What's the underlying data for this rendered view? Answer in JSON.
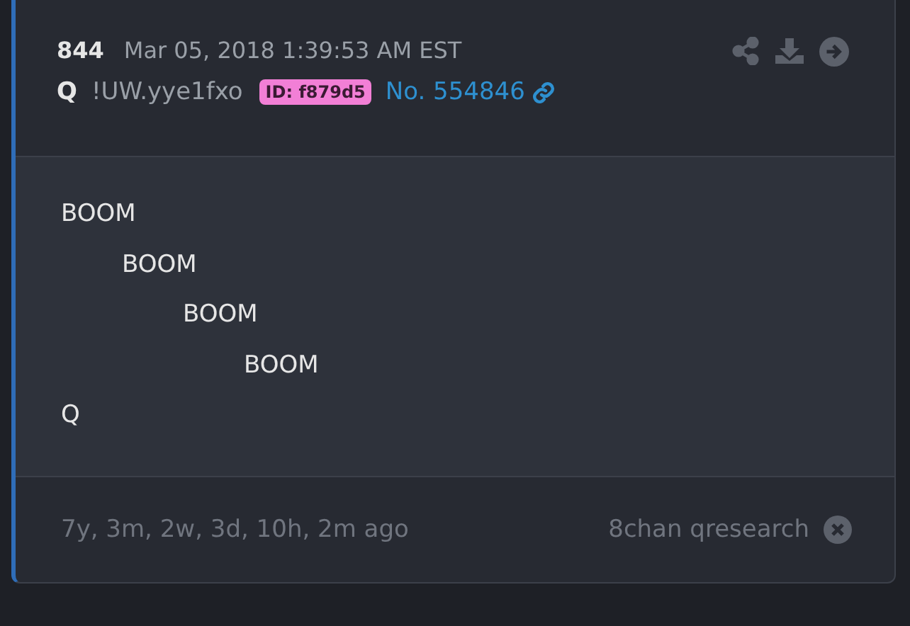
{
  "post": {
    "number": "844",
    "timestamp": "Mar 05, 2018 1:39:53 AM EST",
    "author": "Q",
    "tripcode": "!UW.yye1fxo",
    "id_badge": {
      "text": "ID: f879d5",
      "color": "#f27fd6"
    },
    "post_link": "No. 554846"
  },
  "body": {
    "lines": [
      {
        "text": "BOOM",
        "children": [
          {
            "text": "BOOM",
            "children": [
              {
                "text": "BOOM",
                "children": [
                  {
                    "text": "BOOM"
                  }
                ]
              }
            ]
          }
        ]
      },
      {
        "text": "Q"
      }
    ]
  },
  "footer": {
    "age": "7y, 3m, 2w, 3d, 10h, 2m ago",
    "source": "8chan qresearch"
  }
}
